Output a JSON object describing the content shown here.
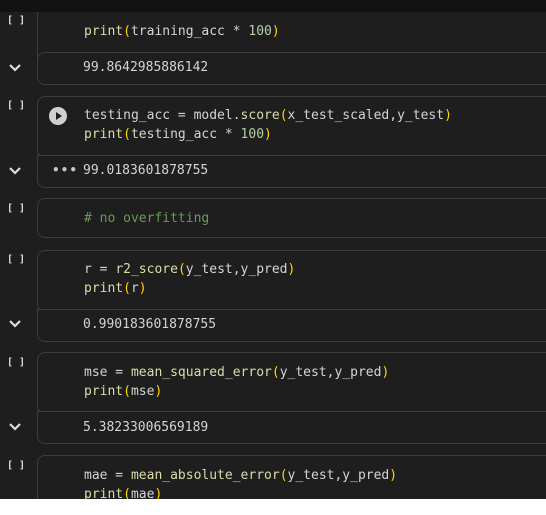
{
  "cells": [
    {
      "id": "c1",
      "exec_count": "[ ]",
      "code": [
        [
          {
            "t": "print",
            "c": "fn"
          },
          {
            "t": "(",
            "c": "paren"
          },
          {
            "t": "training_acc * ",
            "c": ""
          },
          {
            "t": "100",
            "c": "num"
          },
          {
            "t": ")",
            "c": "paren"
          }
        ]
      ],
      "output": "99.8642985886142"
    },
    {
      "id": "c2",
      "exec_count": "[ ]",
      "code": [
        [
          {
            "t": "testing_acc = model.",
            "c": ""
          },
          {
            "t": "score",
            "c": "fn"
          },
          {
            "t": "(",
            "c": "paren"
          },
          {
            "t": "x_test_scaled,y_test",
            "c": ""
          },
          {
            "t": ")",
            "c": "paren"
          }
        ],
        [
          {
            "t": "print",
            "c": "fn"
          },
          {
            "t": "(",
            "c": "paren"
          },
          {
            "t": "testing_acc * ",
            "c": ""
          },
          {
            "t": "100",
            "c": "num"
          },
          {
            "t": ")",
            "c": "paren"
          }
        ]
      ],
      "output": "99.0183601878755"
    },
    {
      "id": "c3",
      "exec_count": "[ ]",
      "code": [
        [
          {
            "t": "# no overfitting",
            "c": "comment"
          }
        ]
      ]
    },
    {
      "id": "c4",
      "exec_count": "[ ]",
      "code": [
        [
          {
            "t": "r = ",
            "c": ""
          },
          {
            "t": "r2_score",
            "c": "fn"
          },
          {
            "t": "(",
            "c": "paren"
          },
          {
            "t": "y_test,y_pred",
            "c": ""
          },
          {
            "t": ")",
            "c": "paren"
          }
        ],
        [
          {
            "t": "print",
            "c": "fn"
          },
          {
            "t": "(",
            "c": "paren"
          },
          {
            "t": "r",
            "c": ""
          },
          {
            "t": ")",
            "c": "paren"
          }
        ]
      ],
      "output": "0.990183601878755"
    },
    {
      "id": "c5",
      "exec_count": "[ ]",
      "code": [
        [
          {
            "t": "mse = ",
            "c": ""
          },
          {
            "t": "mean_squared_error",
            "c": "fn"
          },
          {
            "t": "(",
            "c": "paren"
          },
          {
            "t": "y_test,y_pred",
            "c": ""
          },
          {
            "t": ")",
            "c": "paren"
          }
        ],
        [
          {
            "t": "print",
            "c": "fn"
          },
          {
            "t": "(",
            "c": "paren"
          },
          {
            "t": "mse",
            "c": ""
          },
          {
            "t": ")",
            "c": "paren"
          }
        ]
      ],
      "output": "5.38233006569189"
    },
    {
      "id": "c6",
      "exec_count": "[ ]",
      "code": [
        [
          {
            "t": "mae = ",
            "c": ""
          },
          {
            "t": "mean_absolute_error",
            "c": "fn"
          },
          {
            "t": "(",
            "c": "paren"
          },
          {
            "t": "y_test,y_pred",
            "c": ""
          },
          {
            "t": ")",
            "c": "paren"
          }
        ],
        [
          {
            "t": "print",
            "c": "fn"
          },
          {
            "t": "(",
            "c": "paren"
          },
          {
            "t": "mae",
            "c": ""
          },
          {
            "t": ")",
            "c": "paren"
          }
        ]
      ]
    }
  ],
  "output_menu_label": "•••",
  "icons": {
    "collapse": "chevron-down-icon",
    "run": "play-icon",
    "more": "more-horizontal-icon"
  },
  "colors": {
    "background": "#1e1e1e",
    "cell_border": "#3c3c3c",
    "function": "#dcdcaa",
    "paren": "#ffd700",
    "number": "#b5cea8",
    "comment": "#6a9955",
    "text": "#d4d4d4"
  }
}
